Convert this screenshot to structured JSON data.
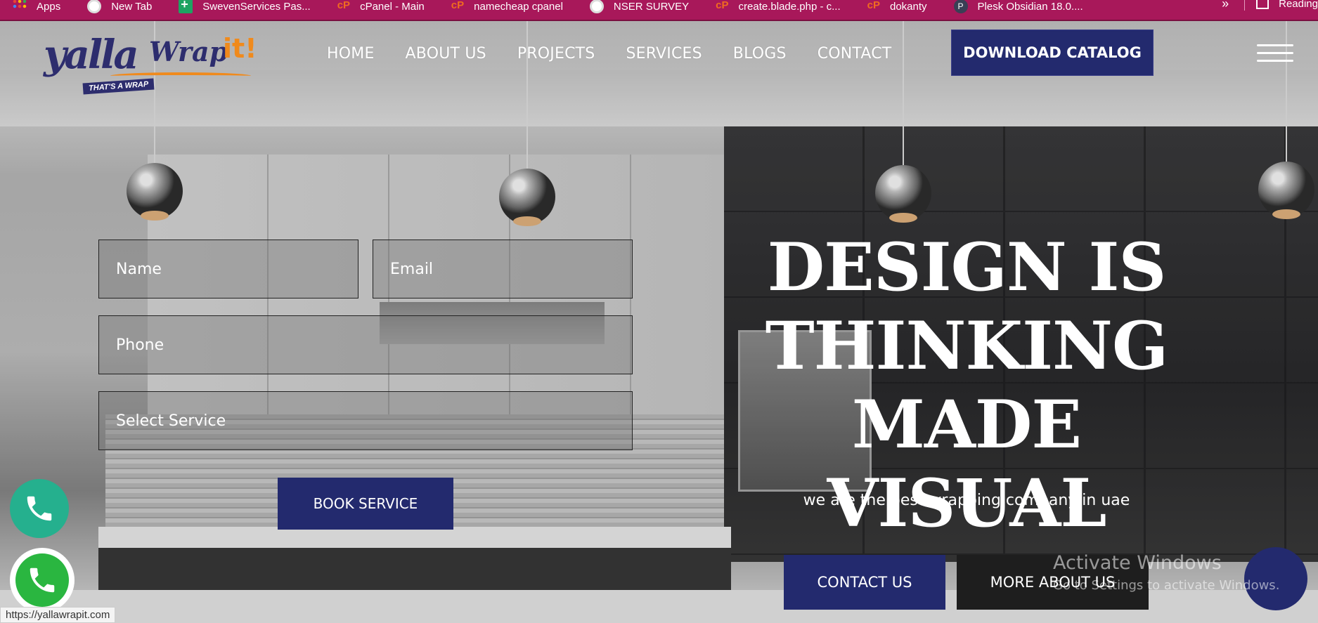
{
  "bookmarks": {
    "items": [
      {
        "label": "Apps",
        "icon": "apps-grid-icon"
      },
      {
        "label": "New Tab",
        "icon": "globe-icon"
      },
      {
        "label": "SwevenServices Pas...",
        "icon": "sheets-plus-icon"
      },
      {
        "label": "cPanel - Main",
        "icon": "cpanel-icon"
      },
      {
        "label": "namecheap cpanel",
        "icon": "cpanel-icon"
      },
      {
        "label": "NSER SURVEY",
        "icon": "globe-icon"
      },
      {
        "label": "create.blade.php - c...",
        "icon": "cpanel-icon"
      },
      {
        "label": "dokanty",
        "icon": "cpanel-icon"
      },
      {
        "label": "Plesk Obsidian 18.0....",
        "icon": "plesk-icon"
      }
    ],
    "more_label": "»",
    "reading_list_label": "Reading"
  },
  "logo": {
    "word": "yalla",
    "wrap": "Wrap",
    "it": "it!",
    "tagline": "THAT'S A WRAP"
  },
  "nav": {
    "items": [
      "HOME",
      "ABOUT US",
      "PROJECTS",
      "SERVICES",
      "BLOGS",
      "CONTACT"
    ],
    "catalog_label": "DOWNLOAD CATALOG"
  },
  "form": {
    "name_placeholder": "Name",
    "email_placeholder": "Email",
    "phone_placeholder": "Phone",
    "service_placeholder": "Select Service",
    "submit_label": "BOOK SERVICE"
  },
  "hero": {
    "headline_line1": "DESIGN IS",
    "headline_line2": "THINKING MADE",
    "headline_line3": "VISUAL",
    "subtitle": "we are the best wrapping company in uae",
    "contact_label": "CONTACT US",
    "more_label": "MORE ABOUT US"
  },
  "watermark": {
    "line1": "Activate Windows",
    "line2": "Go to Settings to activate Windows."
  },
  "status_url": "https://yallawrapit.com",
  "colors": {
    "bookmark_bar": "#a8185a",
    "brand_navy": "#232a6e",
    "brand_orange": "#f08a1c",
    "phone_green": "#25b08e",
    "whatsapp_green": "#2ab640"
  }
}
